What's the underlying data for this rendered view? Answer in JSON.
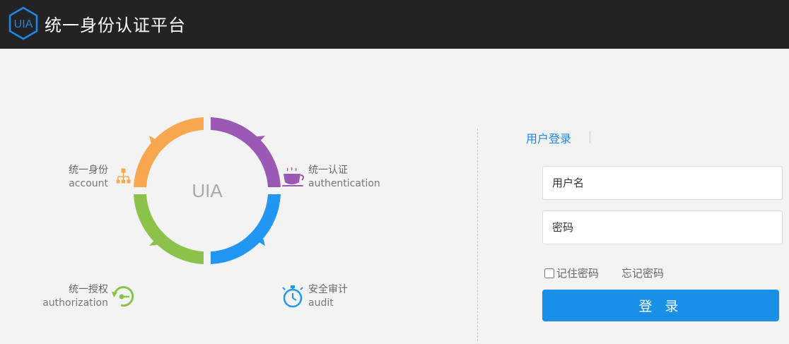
{
  "header": {
    "logo_text": "UIA",
    "title": "统一身份认证平台"
  },
  "diagram": {
    "center_text": "UIA",
    "segments": [
      {
        "zh": "统一身份",
        "en": "account",
        "color": "#f7a84f",
        "icon": "org-chart-icon"
      },
      {
        "zh": "统一认证",
        "en": "authentication",
        "color": "#9b59b6",
        "icon": "coffee-cup-icon"
      },
      {
        "zh": "统一授权",
        "en": "authorization",
        "color": "#8bc34a",
        "icon": "key-cycle-icon"
      },
      {
        "zh": "安全审计",
        "en": "audit",
        "color": "#2196f3",
        "icon": "stopwatch-icon"
      }
    ]
  },
  "login": {
    "tab_label": "用户登录",
    "username_placeholder": "用户名",
    "password_placeholder": "密码",
    "remember_label": "记住密码",
    "forgot_label": "忘记密码",
    "submit_label": "登 录"
  },
  "colors": {
    "header_bg": "#232323",
    "accent": "#1a8fe8",
    "page_bg": "#f3f3f3"
  }
}
